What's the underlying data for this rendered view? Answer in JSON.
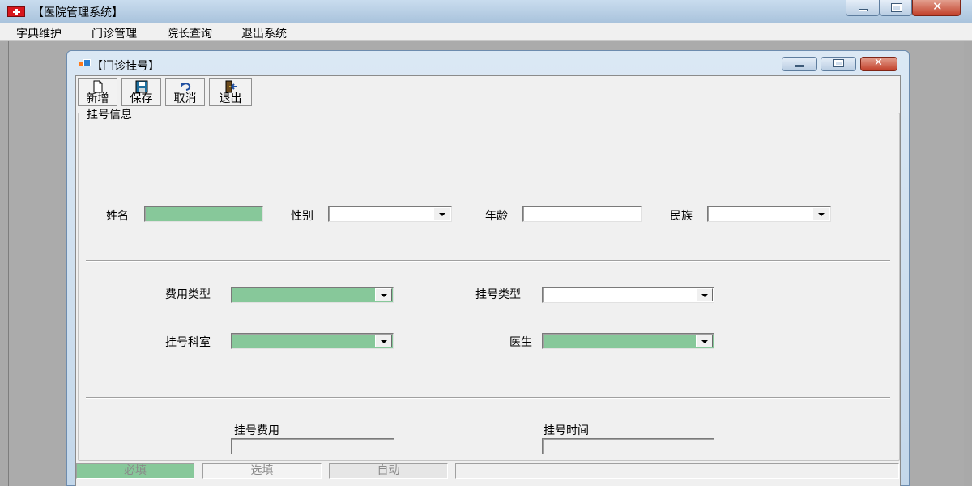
{
  "app": {
    "title": "【医院管理系统】"
  },
  "menu": {
    "items": [
      "字典维护",
      "门诊管理",
      "院长查询",
      "退出系统"
    ]
  },
  "child": {
    "title": "【门诊挂号】"
  },
  "toolbar": {
    "new_label": "新增",
    "save_label": "保存",
    "cancel_label": "取消",
    "exit_label": "退出"
  },
  "group": {
    "title": "挂号信息"
  },
  "form": {
    "name_label": "姓名",
    "gender_label": "性别",
    "age_label": "年龄",
    "ethnicity_label": "民族",
    "fee_type_label": "费用类型",
    "reg_type_label": "挂号类型",
    "department_label": "挂号科室",
    "doctor_label": "医生",
    "reg_fee_label": "挂号费用",
    "reg_time_label": "挂号时间"
  },
  "status": {
    "required": "必填",
    "optional": "选填",
    "auto": "自动"
  },
  "colors": {
    "required_field": "#87c89a",
    "readonly_field": "#f0f0f0"
  },
  "icons": {
    "app": "red-cross-icon",
    "child": "window-form-icon",
    "new": "new-document-icon",
    "save": "floppy-disk-icon",
    "cancel": "undo-arrow-icon",
    "exit": "exit-door-icon"
  }
}
